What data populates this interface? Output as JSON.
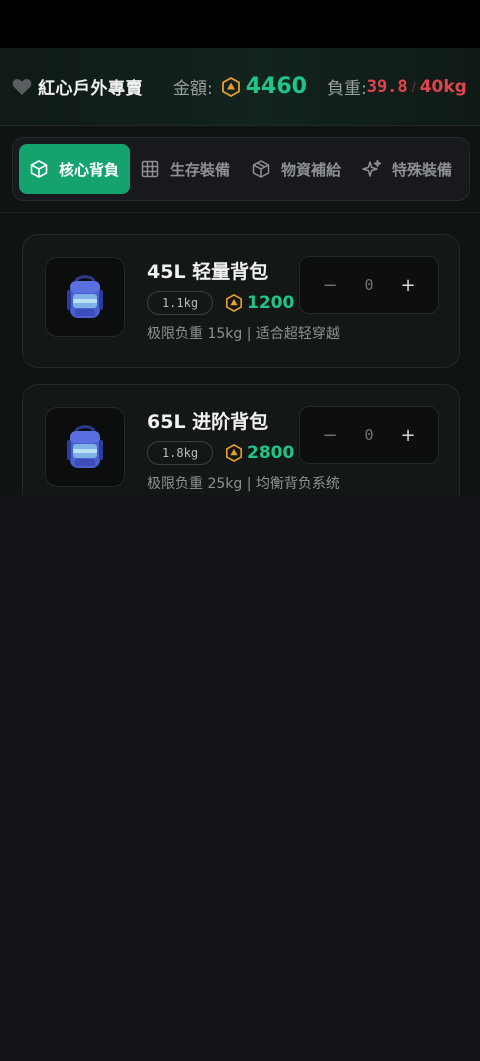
{
  "header": {
    "shop_name": "紅心戶外專賣",
    "money_label": "金額:",
    "money_value": "4460",
    "load_label": "負重:",
    "load_current": "39.8",
    "load_separator": "/",
    "load_max": "40kg"
  },
  "tabs": [
    {
      "label": "核心背負",
      "icon": "box-icon",
      "active": true
    },
    {
      "label": "生存裝備",
      "icon": "grid-icon",
      "active": false
    },
    {
      "label": "物資補給",
      "icon": "package-icon",
      "active": false
    },
    {
      "label": "特殊裝備",
      "icon": "sparkles-icon",
      "active": false
    }
  ],
  "items": [
    {
      "name": "45L 轻量背包",
      "weight": "1.1kg",
      "price": "1200",
      "desc": "极限负重 15kg | 适合超轻穿越",
      "quantity": "0",
      "minus": "−",
      "plus": "+"
    },
    {
      "name": "65L 进阶背包",
      "weight": "1.8kg",
      "price": "2800",
      "desc": "极限负重 25kg | 均衡背负系统",
      "quantity": "0",
      "minus": "−",
      "plus": "+"
    }
  ],
  "colors": {
    "accent": "#14a36e",
    "money": "#20c58a",
    "load": "#e0444f",
    "coin": "#e8a12a"
  }
}
